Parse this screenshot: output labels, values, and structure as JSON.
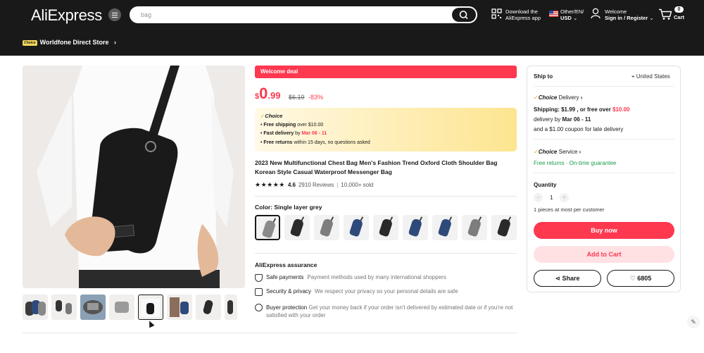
{
  "header": {
    "logo": "AliExpress",
    "search_placeholder": "bag",
    "app_line1": "Download the",
    "app_line2": "AliExpress app",
    "locale_line1": "Other/EN/",
    "locale_line2": "USD",
    "account_line1": "Welcome",
    "account_line2": "Sign in / Register",
    "cart_count": "0",
    "cart_label": "Cart",
    "choice_badge": "Choice",
    "store_name": "Worldfone Direct Store"
  },
  "product": {
    "banner": "Welcome deal",
    "currency": "$",
    "price_int": "0",
    "price_dec": ".99",
    "old_price": "$6.19",
    "discount": "-83%",
    "choice_label": "Choice",
    "choice_rows": [
      {
        "bold": "Free shipping",
        "rest": " over $10.00",
        "red": ""
      },
      {
        "bold": "Fast delivery",
        "rest": " by ",
        "red": "Mar 06 - 11"
      },
      {
        "bold": "Free returns",
        "rest": "  within 15 days, no questions asked",
        "red": ""
      }
    ],
    "title": "2023 New Multifunctional Chest Bag Men's Fashion Trend Oxford Cloth Shoulder Bag Korean Style Casual Waterproof Messenger Bag",
    "stars": "★★★★★",
    "rating": "4.6",
    "reviews": "2910 Reviews",
    "sold": "10,000+ sold",
    "color_label": "Color: Single layer grey",
    "swatch_colors": [
      "#8a8a8a",
      "#2a2a2a",
      "#7d7d7d",
      "#2e4a7a",
      "#2a2a2a",
      "#2e4a7a",
      "#2e4a7a",
      "#7d7d7d",
      "#2a2a2a"
    ],
    "assurance_title": "AliExpress assurance",
    "assurance": [
      {
        "label": "Safe payments",
        "sub": "Payment methods used by many international shoppers"
      },
      {
        "label": "Security & privacy",
        "sub": "We respect your privacy so your personal details are safe"
      },
      {
        "label": "Buyer protection",
        "sub": "Get your money back if your order isn't delivered by estimated date or if you're not satisfied with your order"
      }
    ]
  },
  "panel": {
    "ship_to": "Ship to",
    "country": "United States",
    "choice_delivery": "Delivery",
    "choice_word": "Choice",
    "shipping_line": "Shipping: $1.99 , or free over ",
    "shipping_threshold": "$10.00",
    "delivery_prefix": "delivery by ",
    "delivery_date": "Mar 06 - 11",
    "coupon": "and a $1.00 coupon for late delivery",
    "choice_service": "Service",
    "service_line": "Free returns · On-time guarantee",
    "quantity_label": "Quantity",
    "quantity_value": "1",
    "quantity_note": "1 pieces at most per customer",
    "buy_now": "Buy now",
    "add_to_cart": "Add to Cart",
    "share": "Share",
    "wishlist_count": "6805"
  }
}
